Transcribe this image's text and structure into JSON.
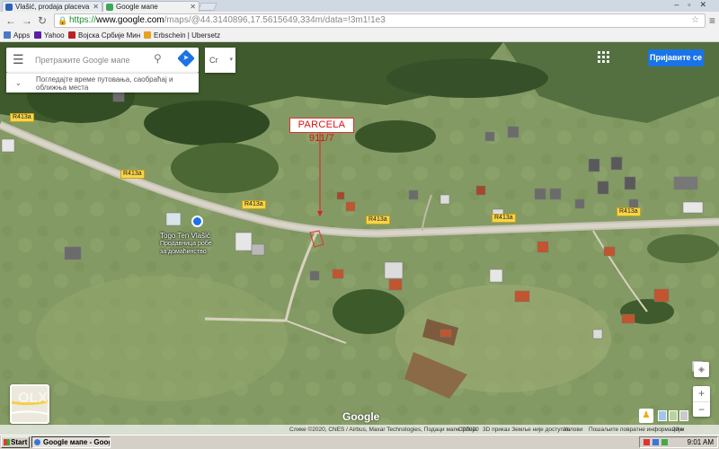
{
  "browser": {
    "tabs": [
      {
        "label": "Vlašić, prodaja placeva",
        "active": false
      },
      {
        "label": "Google мапе",
        "active": true
      }
    ],
    "url": {
      "scheme": "https://",
      "host": "www.google.com",
      "path": "/maps/@44.3140896,17.5615649,334m/data=!3m1!1e3"
    },
    "bookmarks": [
      "Apps",
      "Yahoo",
      "Војска Србије Мин",
      "Erbschein | Ubersetz"
    ]
  },
  "maps": {
    "search_placeholder": "Претражите Google мапе",
    "hint": "Погледајте време путовања, саобраћај и оближња места",
    "layer_label": "Сг",
    "sign_in": "Пријавите се",
    "logo": "Google",
    "road_label": "R413a",
    "road_labels": [
      "R413a",
      "R413a",
      "R413a",
      "R413a",
      "R413a",
      "R413a"
    ],
    "annotation": "PARCELA 911/7",
    "poi_name": "Togo Ten Vlašić",
    "poi_sub1": "Продавница робе",
    "poi_sub2": "за домаћинство",
    "footer": {
      "imagery": "Слике ©2020, CNES / Airbus, Maxar Technologies, Подаци мапе ©2020",
      "region": "Србија",
      "view_3d": "3D приказ Земље није доступан",
      "terms": "Услови",
      "feedback": "Пошаљите повратне информације",
      "scale": "20 м"
    }
  },
  "taskbar": {
    "start": "Start",
    "task": "Google мапе - Google...",
    "clock": "9:01 AM"
  },
  "colors": {
    "accent": "#1a73e8",
    "road_label_bg": "#f7d54b",
    "annotation_red": "#d11111"
  }
}
